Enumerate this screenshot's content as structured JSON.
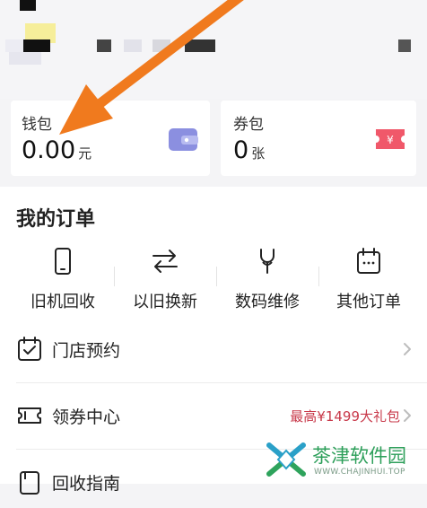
{
  "wallet": {
    "title": "钱包",
    "value": "0.00",
    "unit": "元"
  },
  "coupon_wallet": {
    "title": "券包",
    "value": "0",
    "unit": "张"
  },
  "orders": {
    "title": "我的订单",
    "items": [
      {
        "label": "旧机回收",
        "icon": "phone-icon"
      },
      {
        "label": "以旧换新",
        "icon": "exchange-arrows-icon"
      },
      {
        "label": "数码维修",
        "icon": "wrench-icon"
      },
      {
        "label": "其他订单",
        "icon": "calendar-icon"
      }
    ]
  },
  "menu": [
    {
      "label": "门店预约",
      "icon": "calendar-check-icon",
      "sub": ""
    },
    {
      "label": "领券中心",
      "icon": "ticket-icon",
      "sub": "最高¥1499大礼包"
    },
    {
      "label": "回收指南",
      "icon": "guide-icon",
      "sub": ""
    }
  ],
  "watermark": {
    "name": "茶津软件园",
    "url": "WWW.CHAJINHUI.TOP"
  },
  "colors": {
    "accent_red": "#c8394a",
    "arrow": "#f07a1e",
    "wallet_icon": "#8b8fe0",
    "coupon_icon": "#f0586a"
  }
}
